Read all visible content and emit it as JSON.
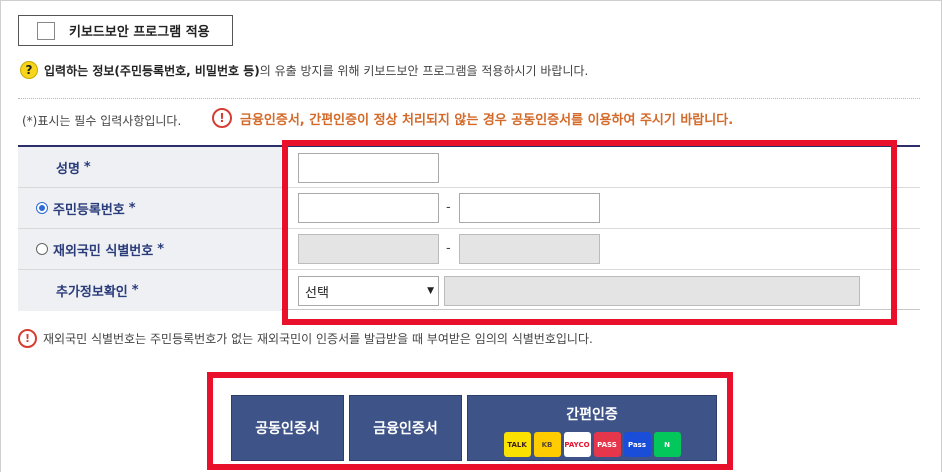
{
  "keyboard_security": {
    "label": "키보드보안 프로그램 적용",
    "checked": false
  },
  "notice_top": {
    "icon": "question-icon",
    "bold_part": "입력하는 정보(주민등록번호, 비밀번호 등)",
    "rest": "의 유출 방지를 위해 키보드보안 프로그램을 적용하시기 바랍니다."
  },
  "required_note": "(*)표시는 필수 입력사항입니다.",
  "warning": {
    "icon": "exclamation-icon",
    "text": "금융인증서, 간편인증이 정상 처리되지 않는 경우 공동인증서를 이용하여 주시기 바랍니다."
  },
  "form": {
    "name": {
      "label": "성명",
      "required_mark": "*"
    },
    "resident": {
      "label": "주민등록번호",
      "required_mark": "*",
      "selected": true,
      "separator": "-"
    },
    "foreign": {
      "label": "재외국민 식별번호",
      "required_mark": "*",
      "selected": false,
      "separator": "-"
    },
    "extra": {
      "label": "추가정보확인",
      "required_mark": "*",
      "select_value": "선택",
      "select_arrow": "▼"
    }
  },
  "notice_bottom": {
    "icon": "exclamation-icon",
    "text": "재외국민 식별번호는 주민등록번호가 없는 재외국민이 인증서를 발급받을 때 부여받은 임의의 식별번호입니다."
  },
  "auth_buttons": {
    "joint": "공동인증서",
    "financial": "금융인증서",
    "easy": "간편인증",
    "providers": [
      {
        "name": "kakaotalk-logo",
        "text": "TALK",
        "bg": "#fae100",
        "fg": "#3b1e1e"
      },
      {
        "name": "kb-logo",
        "text": "KB",
        "bg": "#ffcc00",
        "fg": "#5a4a32"
      },
      {
        "name": "payco-logo",
        "text": "PAYCO",
        "bg": "#ffffff",
        "fg": "#e8102a"
      },
      {
        "name": "pass-logo",
        "text": "PASS",
        "bg": "#e6364c",
        "fg": "#ffffff"
      },
      {
        "name": "samsung-pass-logo",
        "text": "Pass",
        "bg": "#1b4ed8",
        "fg": "#ffffff"
      },
      {
        "name": "naver-logo",
        "text": "N",
        "bg": "#03c75a",
        "fg": "#ffffff"
      }
    ]
  },
  "colors": {
    "highlight_border": "#e8102a",
    "button_bg": "#3e5488",
    "label_text": "#2a3b7a",
    "warning_text": "#d36a2a"
  }
}
